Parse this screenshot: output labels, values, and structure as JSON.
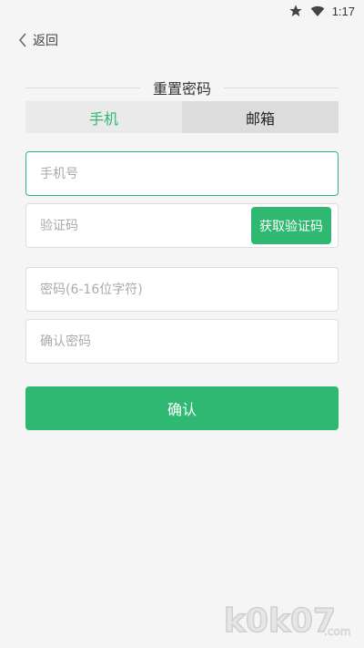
{
  "status_bar": {
    "time": "1:17"
  },
  "header": {
    "back_label": "返回"
  },
  "title": "重置密码",
  "tabs": [
    {
      "label": "手机",
      "active": true
    },
    {
      "label": "邮箱",
      "active": false
    }
  ],
  "form": {
    "phone_placeholder": "手机号",
    "code_placeholder": "验证码",
    "get_code_label": "获取验证码",
    "password_placeholder": "密码(6-16位字符)",
    "confirm_password_placeholder": "确认密码"
  },
  "confirm_label": "确认",
  "watermark_text": "k0k07.com",
  "colors": {
    "accent": "#2eb872",
    "background": "#f5f5f5"
  }
}
